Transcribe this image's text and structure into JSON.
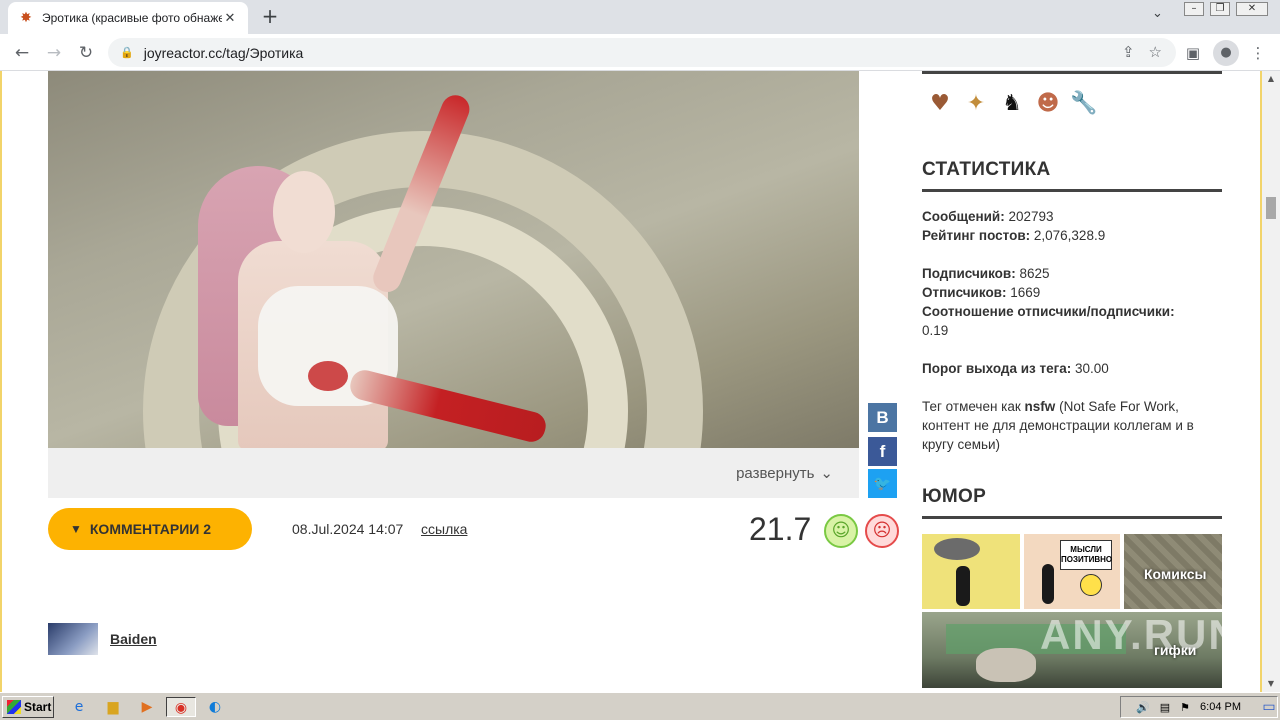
{
  "browser": {
    "tab_title": "Эротика (красивые фото обнажен",
    "tab_close": "✕",
    "new_tab": "+",
    "url": "joyreactor.cc/tag/Эротика",
    "icons": [
      "favicon-star-icon",
      "back-icon",
      "forward-icon",
      "reload-icon",
      "lock-icon",
      "share-icon",
      "bookmark-star-icon",
      "sidebar-icon",
      "profile-icon",
      "menu-icon"
    ]
  },
  "post": {
    "expand_label": "развернуть",
    "comments_label": "КОММЕНТАРИИ 2",
    "date": "08.Jul.2024 14:07",
    "link_label": "ссылка",
    "rating": "21.7"
  },
  "share": {
    "vk": "В",
    "fb": "f",
    "tw": "🐦"
  },
  "comment": {
    "username": "Baiden"
  },
  "sidebar": {
    "stats_title": "СТАТИСТИКА",
    "stats": {
      "messages_label": "Сообщений:",
      "messages_value": "202793",
      "rating_label": "Рейтинг постов:",
      "rating_value": "2,076,328.9",
      "subscribers_label": "Подписчиков:",
      "subscribers_value": "8625",
      "unsubscribers_label": "Отписчиков:",
      "unsubscribers_value": "1669",
      "ratio_label": "Соотношение отписчики/подписчики:",
      "ratio_value": "0.19",
      "exit_label": "Порог выхода из тега:",
      "exit_value": "30.00",
      "tag_prefix": "Тег отмечен как",
      "tag_bold": "nsfw",
      "tag_suffix": "(Not Safe For Work, контент не для демонстрации коллегам и в кругу семьи)"
    },
    "humor_title": "ЮМОР",
    "tiles": {
      "comics": "Комиксы",
      "gifs": "гифки",
      "thought": "МЫСЛИ ПОЗИТИВНО"
    }
  },
  "watermark": "ANY.RUN",
  "taskbar": {
    "start": "Start",
    "time": "6:04 PM"
  }
}
